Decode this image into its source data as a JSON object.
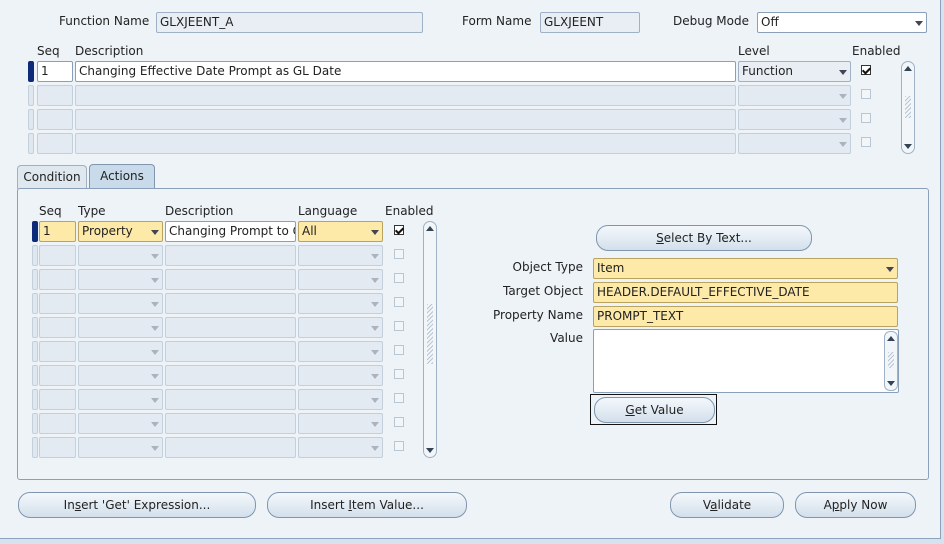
{
  "header": {
    "function_name_label": "Function Name",
    "function_name_value": "GLXJEENT_A",
    "form_name_label": "Form Name",
    "form_name_value": "GLXJEENT",
    "debug_mode_label": "Debug Mode",
    "debug_mode_value": "Off"
  },
  "personalization": {
    "col_seq": "Seq",
    "col_description": "Description",
    "col_level": "Level",
    "col_enabled": "Enabled",
    "rows": [
      {
        "seq": "1",
        "description": "Changing Effective Date Prompt as GL Date",
        "level": "Function",
        "enabled": true
      }
    ]
  },
  "tabs": {
    "condition": "Condition",
    "actions": "Actions"
  },
  "actions": {
    "col_seq": "Seq",
    "col_type": "Type",
    "col_description": "Description",
    "col_language": "Language",
    "col_enabled": "Enabled",
    "rows": [
      {
        "seq": "1",
        "type": "Property",
        "description": "Changing Prompt to G",
        "language": "All",
        "enabled": true
      }
    ]
  },
  "details": {
    "select_by_text_pre": "",
    "select_by_text_u": "S",
    "select_by_text_post": "elect By Text...",
    "object_type_label": "Object Type",
    "object_type_value": "Item",
    "target_object_label": "Target Object",
    "target_object_value": "HEADER.DEFAULT_EFFECTIVE_DATE",
    "property_name_label": "Property Name",
    "property_name_value": "PROMPT_TEXT",
    "value_label": "Value",
    "get_value_u": "G",
    "get_value_post": "et Value"
  },
  "footer": {
    "insert_get_pre": "In",
    "insert_get_u": "s",
    "insert_get_post": "ert 'Get' Expression...",
    "insert_item_pre": "Insert ",
    "insert_item_u": "I",
    "insert_item_post": "tem Value...",
    "validate_pre": "V",
    "validate_u": "a",
    "validate_post": "lidate",
    "apply_pre": "A",
    "apply_u": "p",
    "apply_post": "ply Now"
  },
  "colors": {
    "selected_row_marker": "#0e2a78",
    "required_field": "#fde9a8",
    "window_bg": "#eef3f8"
  }
}
